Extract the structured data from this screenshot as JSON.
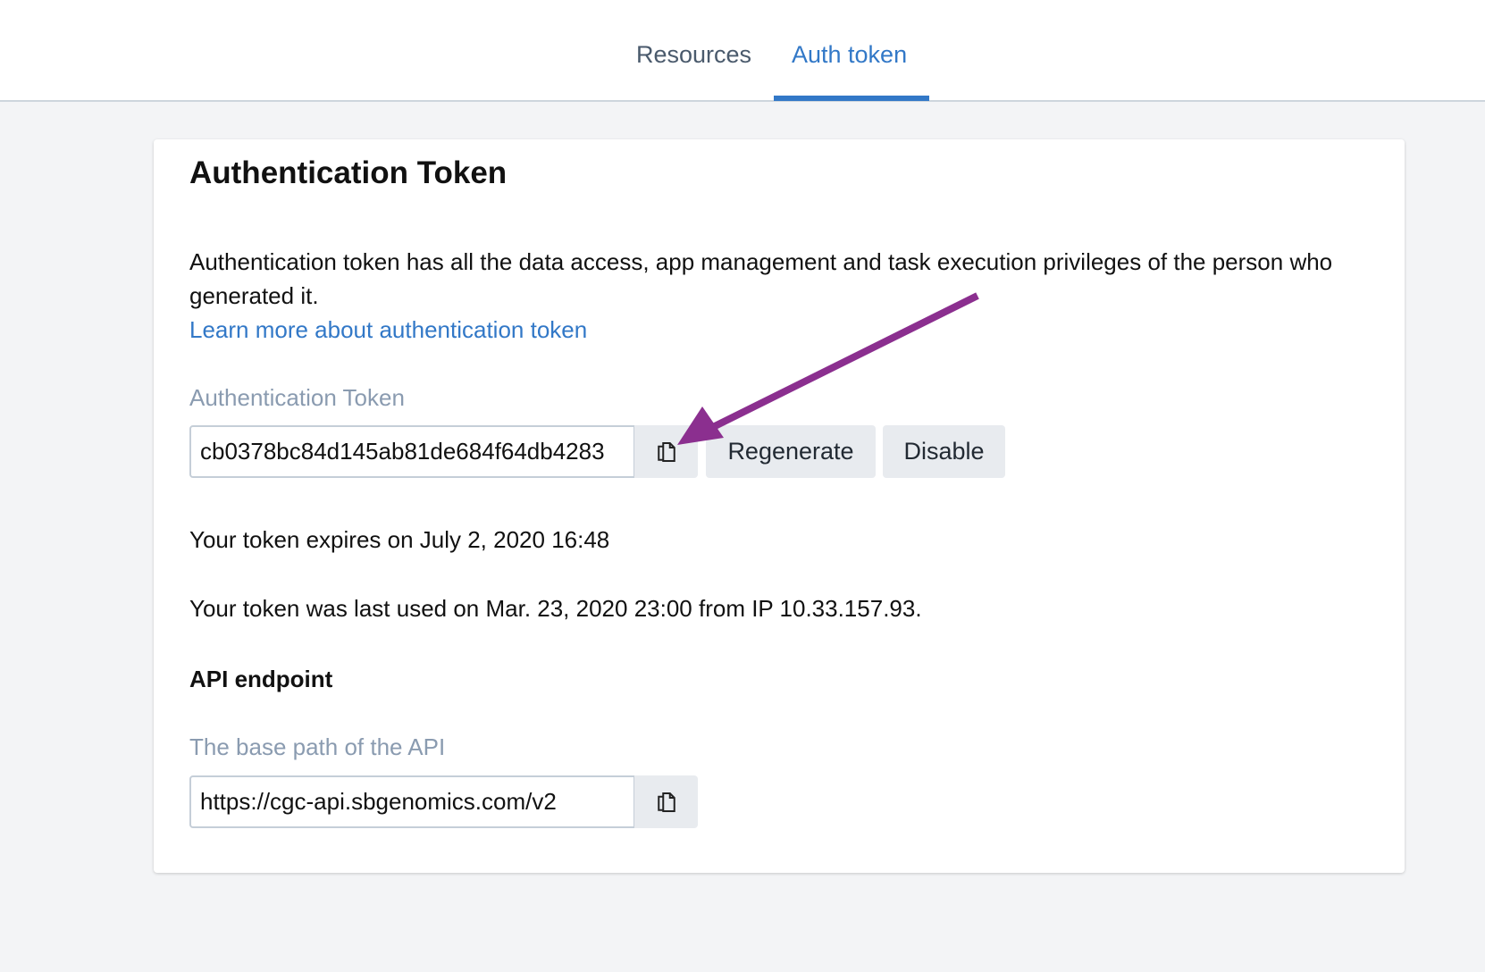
{
  "tabs": [
    {
      "label": "Resources"
    },
    {
      "label": "Auth token"
    }
  ],
  "card": {
    "title": "Authentication Token",
    "description": "Authentication token has all the data access, app management and task execution privileges of the person who generated it.",
    "learn_more": "Learn more about authentication token",
    "token_label": "Authentication Token",
    "token_value": "cb0378bc84d145ab81de684f64db4283",
    "regenerate": "Regenerate",
    "disable": "Disable",
    "expires": "Your token expires on July 2, 2020 16:48",
    "last_used": "Your token was last used on Mar. 23, 2020 23:00 from IP 10.33.157.93.",
    "api_heading": "API endpoint",
    "api_label": "The base path of the API",
    "api_value": "https://cgc-api.sbgenomics.com/v2"
  },
  "colors": {
    "accent": "#3278c7",
    "arrow": "#8b2f8f"
  }
}
